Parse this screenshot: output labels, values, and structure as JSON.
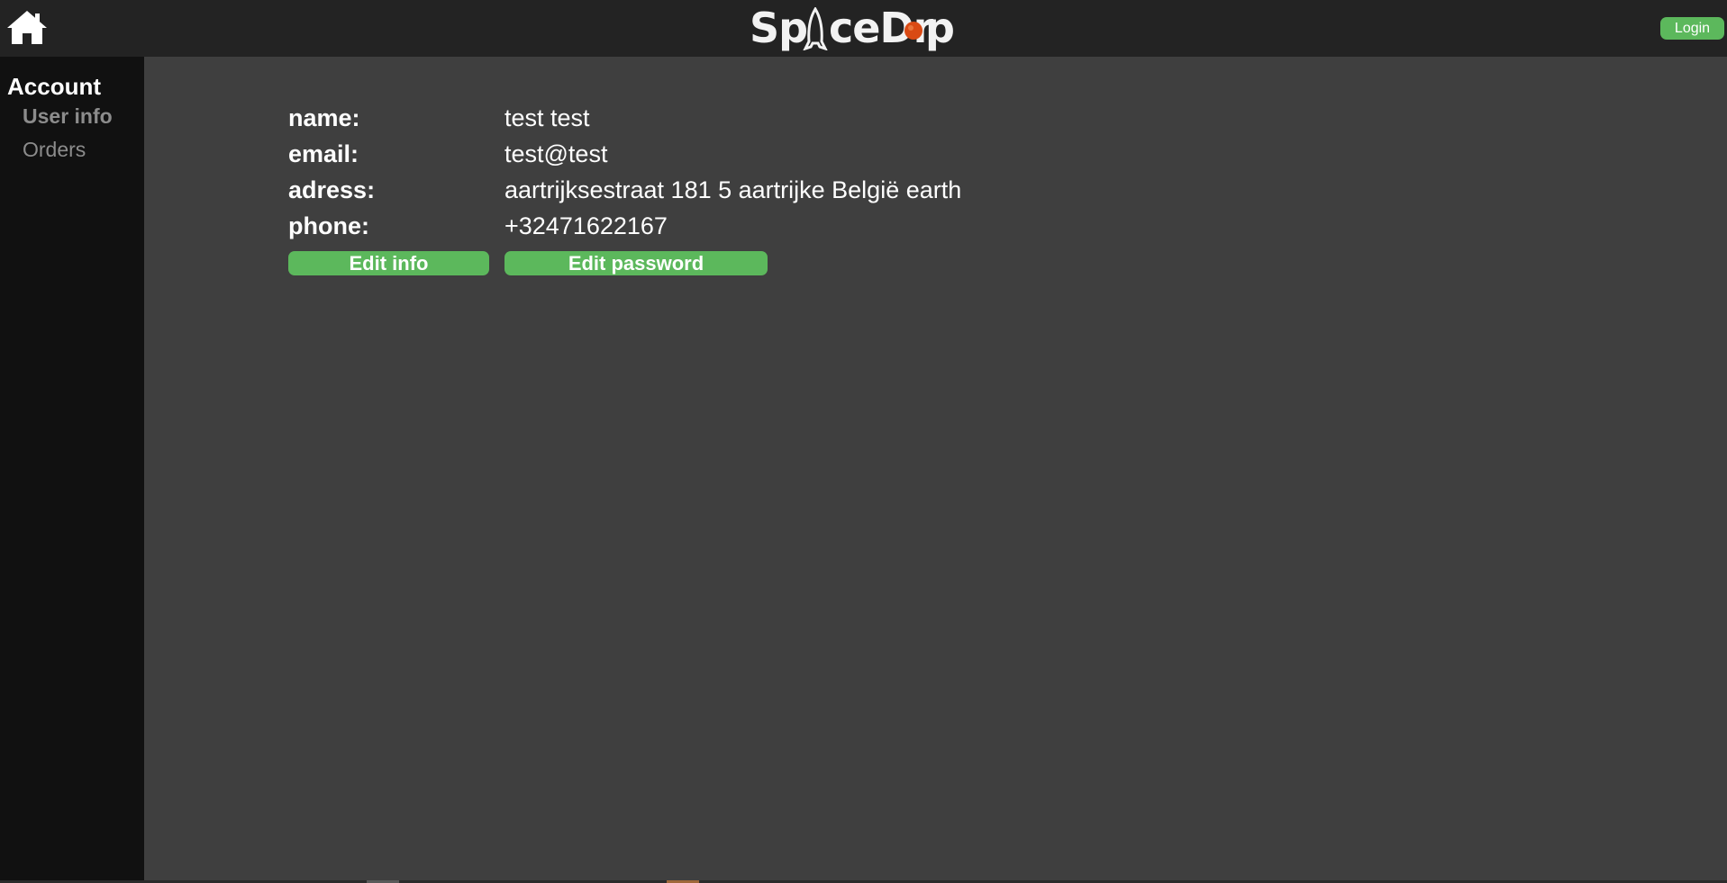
{
  "header": {
    "home_icon": "home-icon",
    "logo_text_left": "Sp",
    "logo_text_right": "ceDr",
    "logo_text_end": "p",
    "logo_alt": "SpaceDrop",
    "login_label": "Login"
  },
  "sidebar": {
    "heading": "Account",
    "items": [
      {
        "label": "User info",
        "active": true
      },
      {
        "label": "Orders",
        "active": false
      }
    ]
  },
  "user": {
    "name_label": "name:",
    "name_value": "test test",
    "email_label": "email:",
    "email_value": "test@test",
    "address_label": "adress:",
    "address_value": "aartrijksestraat 181 5 aartrijke België earth",
    "phone_label": "phone:",
    "phone_value": "+32471622167"
  },
  "actions": {
    "edit_info_label": "Edit info",
    "edit_password_label": "Edit password"
  },
  "colors": {
    "topbar": "#232323",
    "sidebar": "#111111",
    "main": "#3f3f3f",
    "accent_green": "#5cb85c",
    "planet_orange": "#d94a14"
  }
}
